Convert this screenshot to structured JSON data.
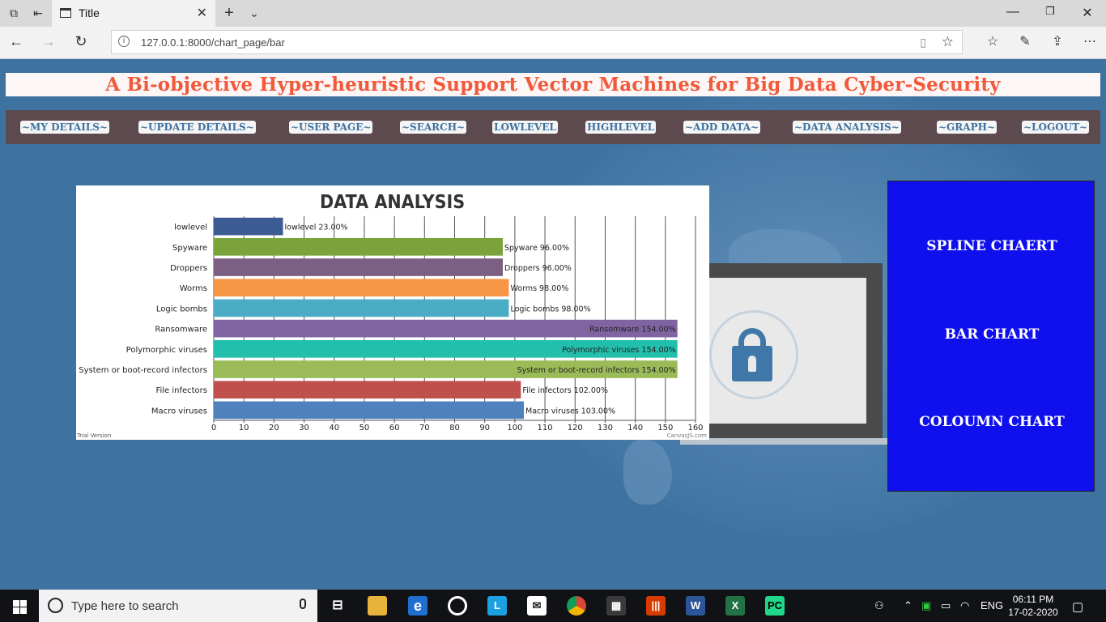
{
  "browser": {
    "tab_title": "Title",
    "url": "127.0.0.1:8000/chart_page/bar"
  },
  "banner": {
    "title": "A Bi-objective Hyper-heuristic Support Vector Machines for Big Data Cyber-Security"
  },
  "nav": {
    "items": [
      {
        "label": "~MY DETAILS~"
      },
      {
        "label": "~UPDATE DETAILS~"
      },
      {
        "label": "~USER PAGE~"
      },
      {
        "label": "~SEARCH~"
      },
      {
        "label": "LOWLEVEL"
      },
      {
        "label": "HIGHLEVEL"
      },
      {
        "label": "~ADD DATA~"
      },
      {
        "label": "~DATA ANALYSIS~"
      },
      {
        "label": "~GRAPH~"
      },
      {
        "label": "~LOGOUT~"
      }
    ]
  },
  "sidepanel": {
    "items": [
      {
        "label": "SPLINE CHAERT"
      },
      {
        "label": "BAR CHART"
      },
      {
        "label": "COLOUMN CHART"
      }
    ]
  },
  "chart_data": {
    "type": "bar",
    "orientation": "horizontal",
    "title": "DATA ANALYSIS",
    "categories": [
      "lowlevel",
      "Spyware",
      "Droppers",
      "Worms",
      "Logic bombs",
      "Ransomware",
      "Polymorphic viruses",
      "System or boot-record infectors",
      "File infectors",
      "Macro viruses"
    ],
    "values": [
      23,
      96,
      96,
      98,
      98,
      154,
      154,
      154,
      102,
      103
    ],
    "data_labels": [
      "lowlevel 23.00%",
      "Spyware 96.00%",
      "Droppers 96.00%",
      "Worms 98.00%",
      "Logic bombs 98.00%",
      "Ransomware 154.00%",
      "Polymorphic viruses 154.00%",
      "System or boot-record infectors 154.00%",
      "File infectors 102.00%",
      "Macro viruses 103.00%"
    ],
    "colors": [
      "#3b5b92",
      "#7ba33b",
      "#7c5f82",
      "#f79646",
      "#4bacc6",
      "#8064a2",
      "#22bfad",
      "#9bbb59",
      "#c0504d",
      "#4f81bd"
    ],
    "xlim": [
      0,
      160
    ],
    "ticks": [
      0,
      10,
      20,
      30,
      40,
      50,
      60,
      70,
      80,
      90,
      100,
      110,
      120,
      130,
      140,
      150,
      160
    ],
    "grid": true,
    "watermark_left": "Trial Version",
    "watermark_right": "CanvasJS.com"
  },
  "taskbar": {
    "search_placeholder": "Type here to search",
    "language": "ENG",
    "time": "06:11 PM",
    "date": "17-02-2020"
  }
}
